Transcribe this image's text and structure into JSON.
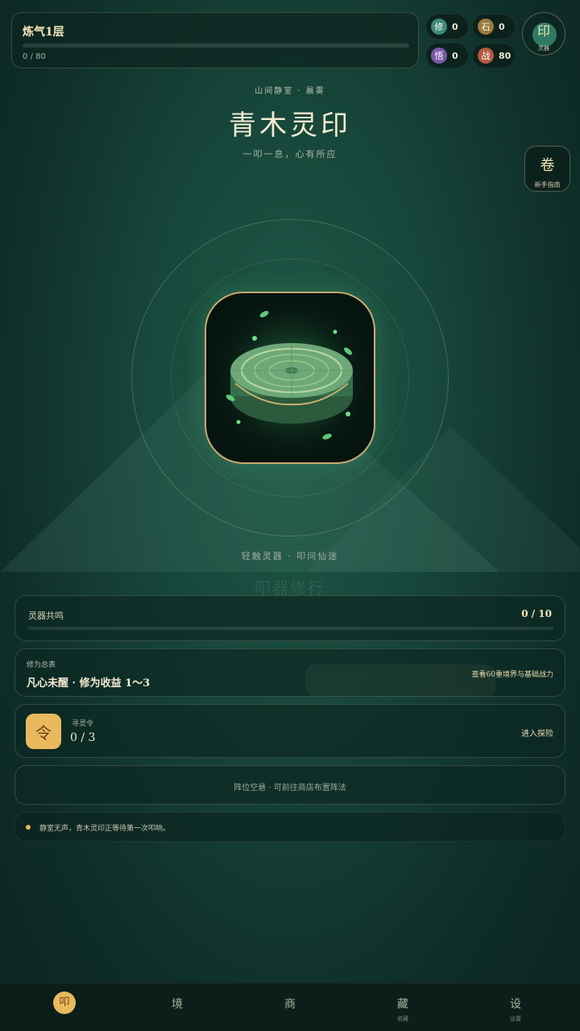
{
  "header": {
    "realm_title": "炼气1层",
    "realm_progress_text": "0 / 80",
    "realm_progress": 0,
    "resources": [
      {
        "glyph": "修",
        "value": "0",
        "color": "#3e8a76"
      },
      {
        "glyph": "石",
        "value": "0",
        "color": "#9a7a3c"
      },
      {
        "glyph": "悟",
        "value": "0",
        "color": "#7a5aa8"
      },
      {
        "glyph": "战",
        "value": "80",
        "color": "#b35a3e"
      }
    ],
    "seal_button": {
      "glyph": "印",
      "label": "灵器"
    }
  },
  "guide_button": {
    "glyph": "卷",
    "label": "新手指南"
  },
  "location": "山间静室 · 晨雾",
  "artifact_title": "青木灵印",
  "artifact_subtitle": "一叩一息，心有所应",
  "tap_hint": "轻触灵器 · 叩问仙途",
  "ghost_title": "叩器修行",
  "resonance": {
    "label": "灵器共鸣",
    "value": "0 / 10",
    "progress": 0
  },
  "cultivation": {
    "label": "修为总表",
    "value": "凡心未醒 · 修为收益 1～3",
    "link": "查看60重境界与基础战力"
  },
  "token": {
    "glyph": "令",
    "label": "寻灵令",
    "value": "0 / 3",
    "link": "进入探险"
  },
  "formation": {
    "text": "阵位空悬 · 可前往商店布置阵法"
  },
  "log": {
    "text": "静室无声，青木灵印正等待第一次叩响。"
  },
  "nav": [
    {
      "glyph": "叩",
      "sub": "",
      "active": true
    },
    {
      "glyph": "境",
      "sub": ""
    },
    {
      "glyph": "商",
      "sub": ""
    },
    {
      "glyph": "藏",
      "sub": "收藏"
    },
    {
      "glyph": "设",
      "sub": "设置"
    }
  ]
}
